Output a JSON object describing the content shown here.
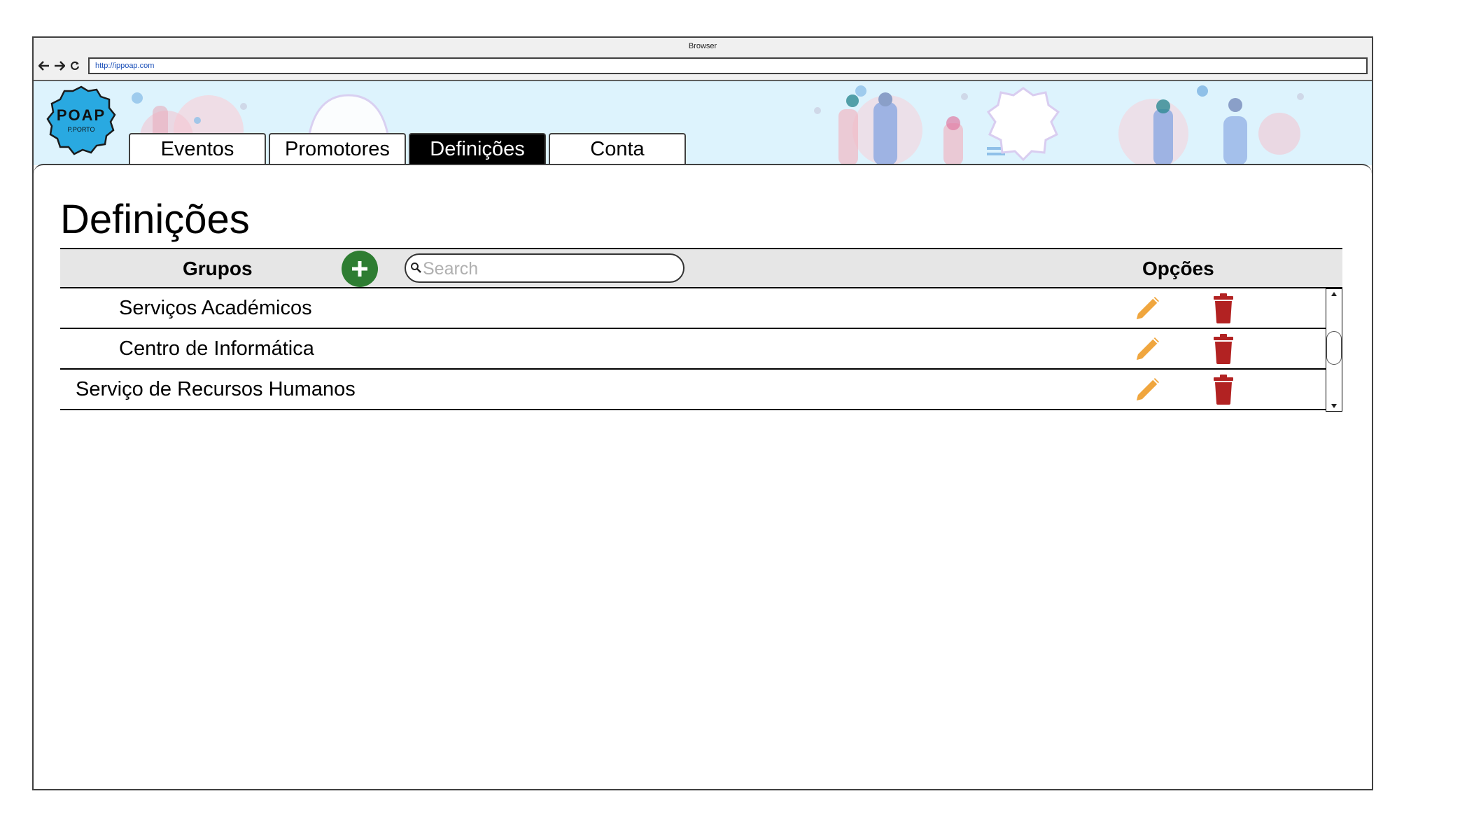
{
  "browser": {
    "title": "Browser",
    "url": "http://ippoap.com"
  },
  "logo": {
    "text": "POAP",
    "subtext": "P.PORTO"
  },
  "tabs": [
    {
      "label": "Eventos",
      "active": false
    },
    {
      "label": "Promotores",
      "active": false
    },
    {
      "label": "Definições",
      "active": true
    },
    {
      "label": "Conta",
      "active": false
    }
  ],
  "page": {
    "title": "Definições"
  },
  "table": {
    "col_groups": "Grupos",
    "col_options": "Opções",
    "search_placeholder": "Search",
    "rows": [
      {
        "label": "Serviços Académicos"
      },
      {
        "label": "Centro de Informática"
      },
      {
        "label": "Serviço de Recursos Humanos"
      }
    ]
  },
  "colors": {
    "banner_bg": "#ddf3fd",
    "add": "#2e7d32",
    "edit": "#f0a63e",
    "delete": "#b22222",
    "logo": "#29a9e1",
    "active_tab": "#000000"
  }
}
